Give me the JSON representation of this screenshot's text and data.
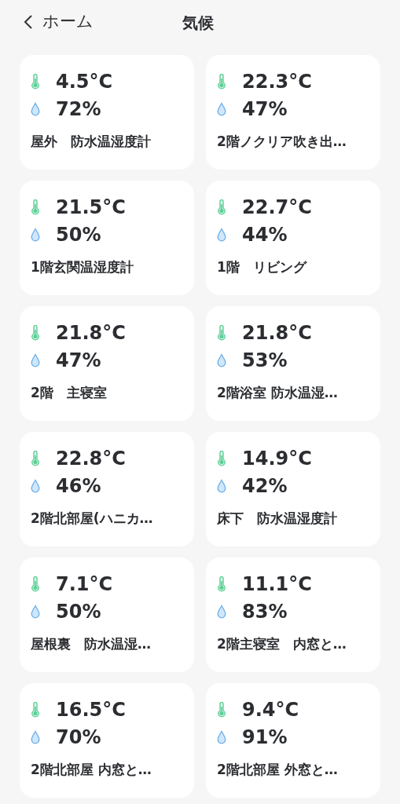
{
  "header": {
    "back": "ホーム",
    "title": "気候"
  },
  "sensors": [
    {
      "temperature": "4.5°C",
      "humidity": "72%",
      "name": "屋外　防水温湿度計"
    },
    {
      "temperature": "22.3°C",
      "humidity": "47%",
      "name": "2階ノクリア吹き出…"
    },
    {
      "temperature": "21.5°C",
      "humidity": "50%",
      "name": "1階玄関温湿度計"
    },
    {
      "temperature": "22.7°C",
      "humidity": "44%",
      "name": "1階　リビング"
    },
    {
      "temperature": "21.8°C",
      "humidity": "47%",
      "name": "2階　主寝室"
    },
    {
      "temperature": "21.8°C",
      "humidity": "53%",
      "name": "2階浴室 防水温湿…"
    },
    {
      "temperature": "22.8°C",
      "humidity": "46%",
      "name": "2階北部屋(ハニカ…"
    },
    {
      "temperature": "14.9°C",
      "humidity": "42%",
      "name": "床下　防水温湿度計"
    },
    {
      "temperature": "7.1°C",
      "humidity": "50%",
      "name": "屋根裏　防水温湿…"
    },
    {
      "temperature": "11.1°C",
      "humidity": "83%",
      "name": "2階主寝室　内窓と…"
    },
    {
      "temperature": "16.5°C",
      "humidity": "70%",
      "name": "2階北部屋 内窓と…"
    },
    {
      "temperature": "9.4°C",
      "humidity": "91%",
      "name": "2階北部屋 外窓と…"
    }
  ]
}
